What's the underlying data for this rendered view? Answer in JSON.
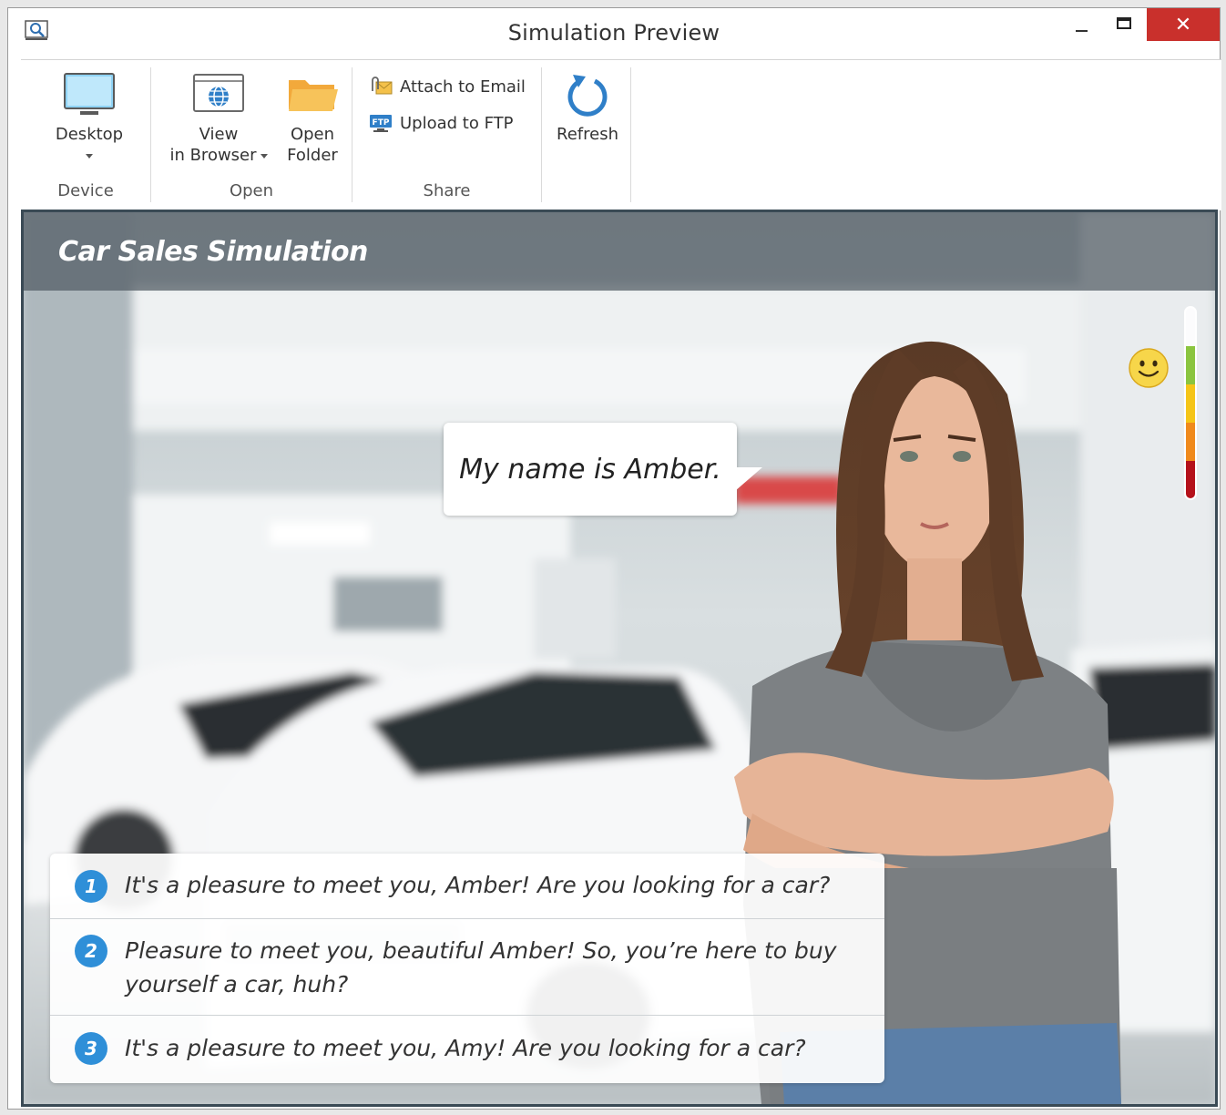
{
  "window": {
    "title": "Simulation Preview",
    "close_glyph": "✕"
  },
  "ribbon": {
    "device": {
      "button_label": "Desktop",
      "group_label": "Device"
    },
    "open": {
      "view_line1": "View",
      "view_line2": "in Browser",
      "folder_line1": "Open",
      "folder_line2": "Folder",
      "group_label": "Open"
    },
    "share": {
      "email_label": "Attach to Email",
      "ftp_label": "Upload to FTP",
      "group_label": "Share"
    },
    "refresh": {
      "label": "Refresh"
    }
  },
  "simulation": {
    "title": "Car Sales Simulation",
    "speech": "My name is Amber.",
    "mood_icon": "smiley-face-icon",
    "mood_meter_colors": [
      "#8bc53f",
      "#f5c518",
      "#f08a1c",
      "#e0401a",
      "#b5121b"
    ],
    "choices": [
      {
        "number": "1",
        "text": "It's a pleasure to meet you, Amber!  Are you looking for a car?"
      },
      {
        "number": "2",
        "text": "Pleasure to meet you, beautiful Amber! So, you’re here to buy yourself a car, huh?"
      },
      {
        "number": "3",
        "text": "It's a pleasure to meet you, Amy!  Are you looking for a car?"
      }
    ]
  }
}
